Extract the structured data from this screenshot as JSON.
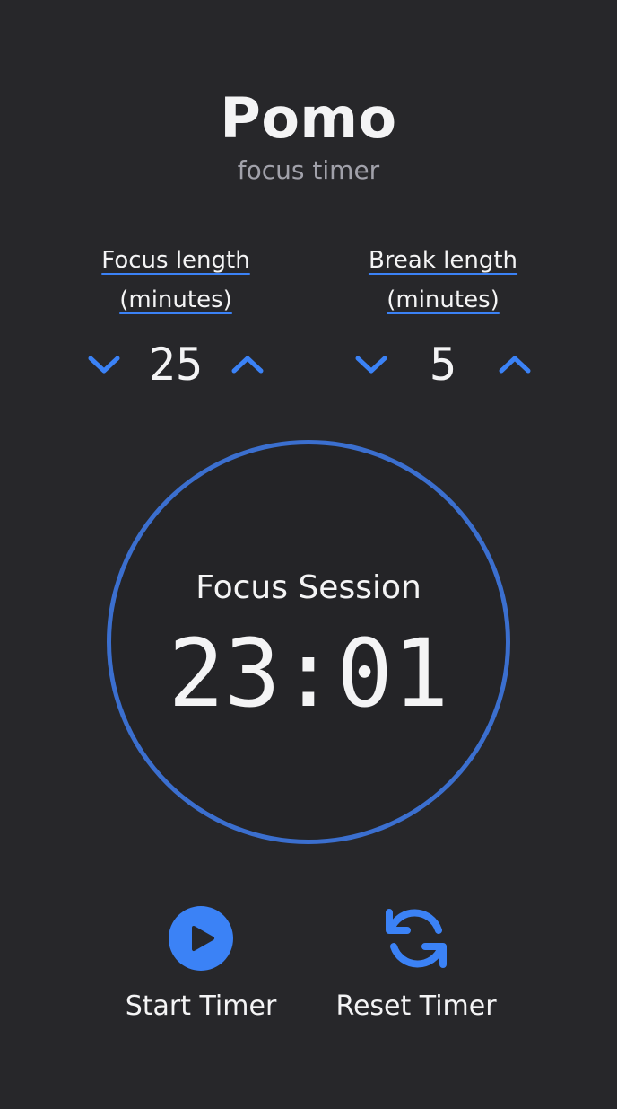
{
  "app": {
    "title": "Pomo",
    "subtitle": "focus timer"
  },
  "settings": {
    "focus": {
      "label_line1": "Focus length",
      "label_line2": "(minutes)",
      "value": "25"
    },
    "break": {
      "label_line1": "Break length",
      "label_line2": "(minutes)",
      "value": "5"
    }
  },
  "timer": {
    "session_label": "Focus Session",
    "time": "23:01"
  },
  "controls": {
    "start_label": "Start Timer",
    "reset_label": "Reset Timer"
  },
  "icons": {
    "decrement": "chevron-down-icon",
    "increment": "chevron-up-icon",
    "start": "play-icon",
    "reset": "refresh-icon"
  },
  "colors": {
    "background": "#27272a",
    "accent": "#3b82f6",
    "ring": "#3b6fcf",
    "text": "#f4f4f5",
    "muted": "#a1a1aa"
  }
}
